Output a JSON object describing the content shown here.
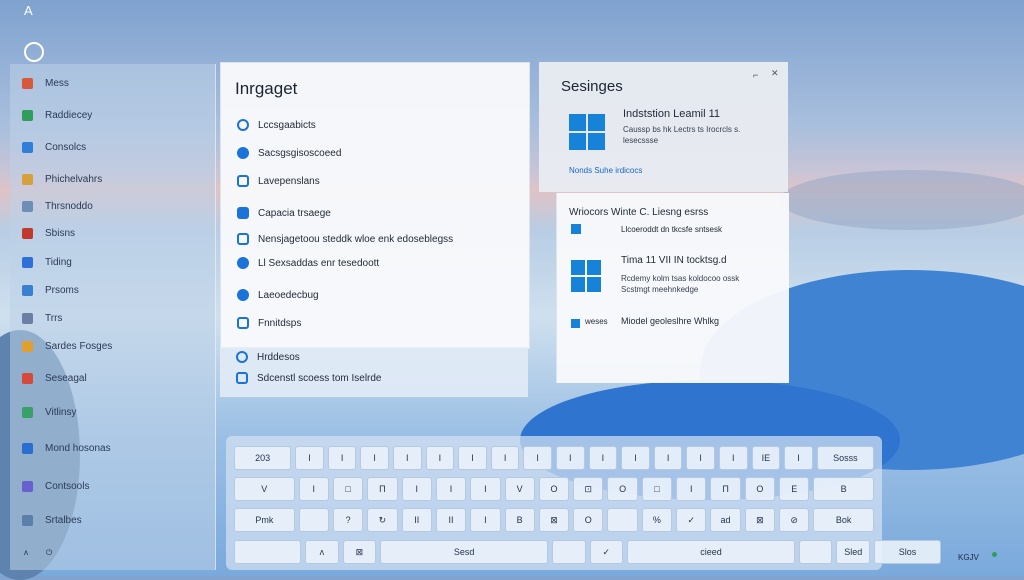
{
  "desktop": {
    "top_letter": "A",
    "tray_text": "KGJV"
  },
  "sidebar": {
    "items": [
      {
        "label": "Mess",
        "color": "#d8583a"
      },
      {
        "label": "Raddiecey",
        "color": "#2e9e5a"
      },
      {
        "label": "Consolcs",
        "color": "#2f7ed8"
      },
      {
        "label": "Phichelvahrs",
        "color": "#d6a13c"
      },
      {
        "label": "Thrsnoddo",
        "color": "#6d8fb5"
      },
      {
        "label": "Sbisns",
        "color": "#c0392b"
      },
      {
        "label": "Tiding",
        "color": "#2f6fd8"
      },
      {
        "label": "Prsoms",
        "color": "#3a7fd0"
      },
      {
        "label": "Trrs",
        "color": "#6b7fa6"
      },
      {
        "label": "Sardes Fosges",
        "color": "#e0a030"
      },
      {
        "label": "Seseagal",
        "color": "#d64a3a"
      },
      {
        "label": "Vitlinsy",
        "color": "#3aa06a"
      },
      {
        "label": "Mond hosonas",
        "color": "#2a6fd0"
      },
      {
        "label": "Contsools",
        "color": "#6a5fd0"
      },
      {
        "label": "Srtalbes",
        "color": "#5b7fa8"
      }
    ]
  },
  "language_panel": {
    "title": "Inrgaget",
    "items": [
      {
        "label": "Lccsgaabicts",
        "icon": "globe-icon"
      },
      {
        "label": "Sacsgsgisoscoeed",
        "icon": "circle-icon"
      },
      {
        "label": "Lavepenslans",
        "icon": "square-icon"
      },
      {
        "label": "Capacia trsaege",
        "icon": "chat-icon"
      },
      {
        "label": "Nensjagetoou steddk wloe enk edoseblegss",
        "icon": "box-icon"
      },
      {
        "label": "Ll Sexsaddas enr tesedoott",
        "icon": "circle-icon"
      },
      {
        "label": "Laeoedecbug",
        "icon": "record-icon"
      },
      {
        "label": "Fnnitdsps",
        "icon": "square-icon"
      },
      {
        "label": "Hrddesos",
        "icon": "globe-icon"
      },
      {
        "label": "Sdcenstl scoess tom Iselrde",
        "icon": "box-icon"
      }
    ]
  },
  "settings_panel": {
    "title": "Sesinges",
    "install_title": "Indststion Leamil 11",
    "install_desc": "Caussp bs hk Lectrs ts Irocrcls s. lesecssse",
    "install_link": "Nonds Suhe irdicocs",
    "section_title": "Wriocors Winte C. Liesng esrss",
    "row1": "Llcoeroddt dn tkcsfe sntsesk",
    "row2_title": "Tima 11 VII IN tocktsg.d",
    "row2_desc": "Rcdemy kolm tsas koldocoo ossk Scstmgt meehnkedge",
    "row3_label": "weses",
    "row3_text": "Miodel geoleslhre Whlkg"
  },
  "keyboard": {
    "rows": [
      [
        "203",
        "I",
        "I",
        "I",
        "I",
        "I",
        "I",
        "I",
        "I",
        "I",
        "I",
        "I",
        "I",
        "I",
        "I",
        "IE",
        "I",
        "Sosss"
      ],
      [
        "V",
        "I",
        "□",
        "П",
        "I",
        "I",
        "I",
        "V",
        "O",
        "⊡",
        "O",
        "□",
        "I",
        "П",
        "O",
        "E",
        "B"
      ],
      [
        "Pmk",
        "",
        "?",
        "↻",
        "II",
        "II",
        "I",
        "B",
        "⊠",
        "O",
        "",
        "%",
        "✓",
        "ad",
        "⊠",
        "⊘",
        "Bok"
      ],
      [
        "",
        "ʌ",
        "⊠",
        "Sesd",
        "",
        "✓",
        "cieed",
        "",
        "Sled",
        "Slos"
      ]
    ]
  }
}
